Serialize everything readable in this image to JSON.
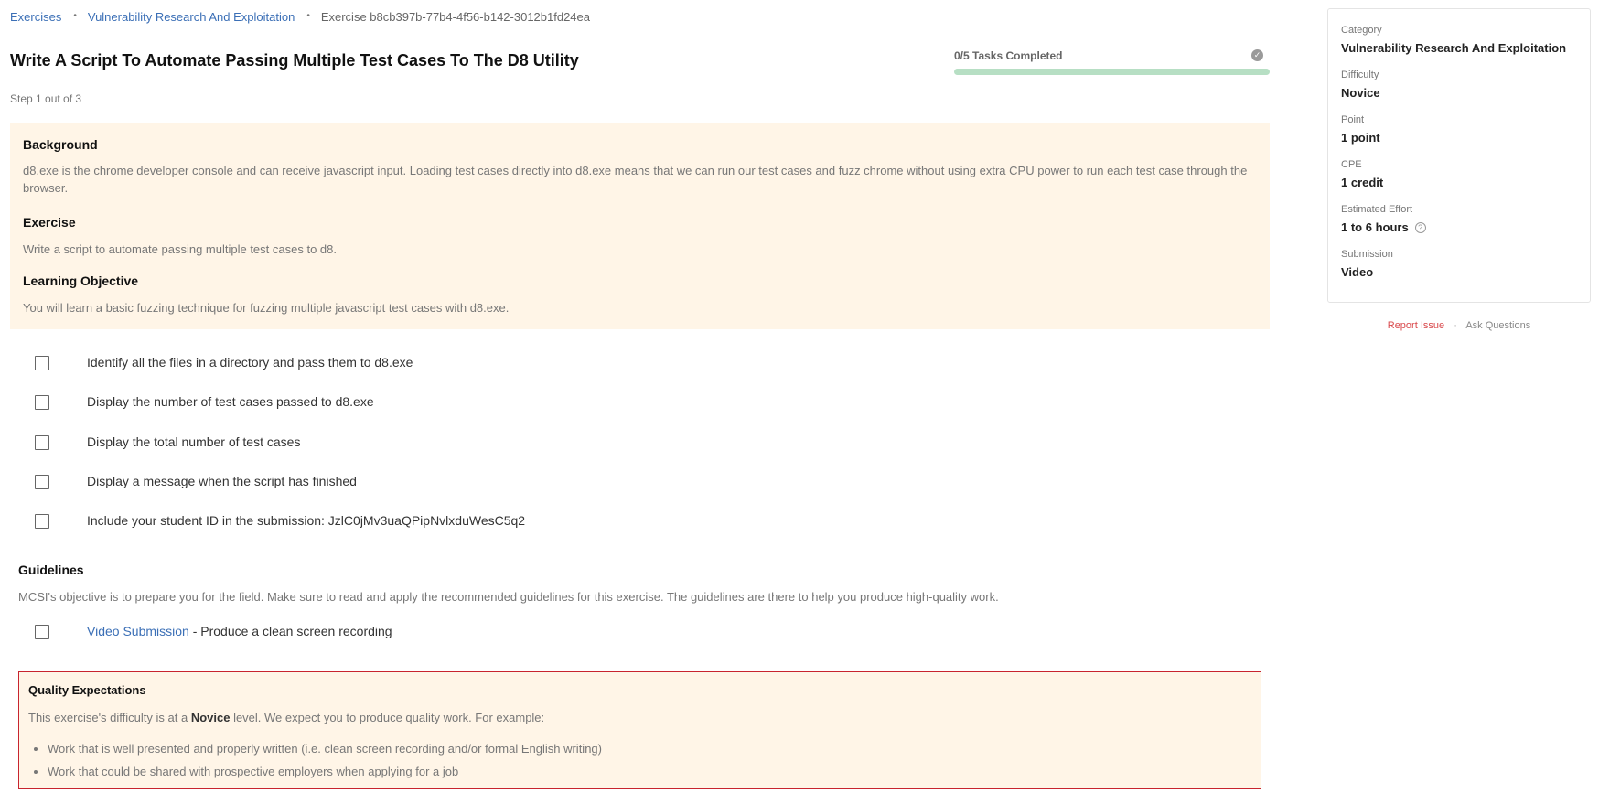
{
  "breadcrumb": {
    "items": [
      "Exercises",
      "Vulnerability Research And Exploitation"
    ],
    "current": "Exercise b8cb397b-77b4-4f56-b142-3012b1fd24ea"
  },
  "title": "Write A Script To Automate Passing Multiple Test Cases To The D8 Utility",
  "step": "Step 1 out of 3",
  "progress": {
    "label": "0/5 Tasks Completed",
    "completed": 0,
    "total": 5,
    "icon": "check-circle-icon"
  },
  "sections": {
    "background": {
      "heading": "Background",
      "text": "d8.exe is the chrome developer console and can receive javascript input. Loading test cases directly into d8.exe means that we can run our test cases and fuzz chrome without using extra CPU power to run each test case through the browser."
    },
    "exercise": {
      "heading": "Exercise",
      "text": "Write a script to automate passing multiple test cases to d8."
    },
    "objective": {
      "heading": "Learning Objective",
      "text": "You will learn a basic fuzzing technique for fuzzing multiple javascript test cases with d8.exe."
    }
  },
  "tasks": [
    {
      "label": "Identify all the files in a directory and pass them to d8.exe",
      "checked": false
    },
    {
      "label": "Display the number of test cases passed to d8.exe",
      "checked": false
    },
    {
      "label": "Display the total number of test cases",
      "checked": false
    },
    {
      "label": "Display a message when the script has finished",
      "checked": false
    },
    {
      "label": "Include your student ID in the submission: JzlC0jMv3uaQPipNvlxduWesC5q2",
      "checked": false
    }
  ],
  "guidelines": {
    "heading": "Guidelines",
    "text": "MCSI's objective is to prepare you for the field. Make sure to read and apply the recommended guidelines for this exercise. The guidelines are there to help you produce high-quality work.",
    "items": [
      {
        "link": "Video Submission",
        "text": " - Produce a clean screen recording",
        "checked": false
      }
    ]
  },
  "quality": {
    "heading": "Quality Expectations",
    "intro_before": "This exercise's difficulty is at a ",
    "level": "Novice",
    "intro_after": " level. We expect you to produce quality work. For example:",
    "items": [
      "Work that is well presented and properly written (i.e. clean screen recording and/or formal English writing)",
      "Work that could be shared with prospective employers when applying for a job"
    ]
  },
  "sidebar": {
    "items": [
      {
        "label": "Category",
        "value": "Vulnerability Research And Exploitation"
      },
      {
        "label": "Difficulty",
        "value": "Novice"
      },
      {
        "label": "Point",
        "value": "1 point"
      },
      {
        "label": "CPE",
        "value": "1 credit"
      },
      {
        "label": "Estimated Effort",
        "value": "1 to 6 hours",
        "icon": "help-circle-icon",
        "icon_glyph": "?"
      },
      {
        "label": "Submission",
        "value": "Video"
      }
    ]
  },
  "links": {
    "report": "Report Issue",
    "ask": "Ask Questions",
    "separator": "·"
  },
  "separators": {
    "breadcrumb": "•"
  },
  "colors": {
    "link": "#3b6fb6",
    "accent_green": "#4caf6a",
    "callout_bg": "#fff5e7",
    "alert_border": "#c8242e",
    "report_red": "#d9484b"
  }
}
